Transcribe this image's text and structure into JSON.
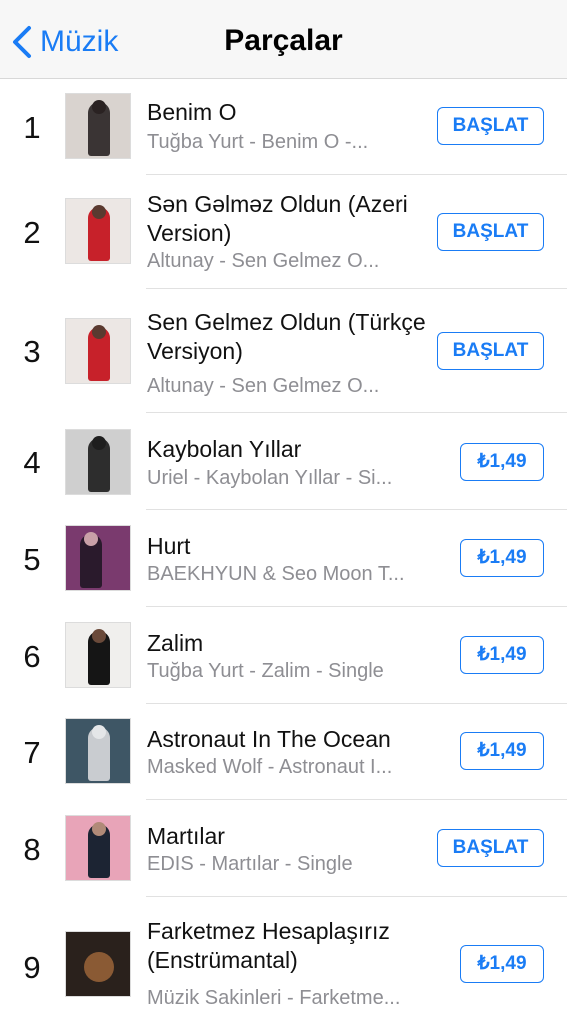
{
  "navbar": {
    "back_label": "Müzik",
    "title": "Parçalar"
  },
  "tracks": [
    {
      "rank": "1",
      "title": "Benim O",
      "subtitle": "Tuğba Yurt - Benim O -...",
      "action": "BAŞLAT"
    },
    {
      "rank": "2",
      "title": "Sən Gəlməz Oldun (Azeri Version)",
      "subtitle": "Altunay - Sen Gelmez O...",
      "action": "BAŞLAT"
    },
    {
      "rank": "3",
      "title": "Sen Gelmez Oldun (Türkçe Versiyon)",
      "subtitle": "Altunay - Sen Gelmez O...",
      "action": "BAŞLAT"
    },
    {
      "rank": "4",
      "title": "Kaybolan Yıllar",
      "subtitle": "Uriel - Kaybolan Yıllar - Si...",
      "action": "₺1,49"
    },
    {
      "rank": "5",
      "title": "Hurt",
      "subtitle": "BAEKHYUN & Seo Moon T...",
      "action": "₺1,49"
    },
    {
      "rank": "6",
      "title": "Zalim",
      "subtitle": "Tuğba Yurt - Zalim - Single",
      "action": "₺1,49"
    },
    {
      "rank": "7",
      "title": "Astronaut In The Ocean",
      "subtitle": "Masked Wolf - Astronaut I...",
      "action": "₺1,49"
    },
    {
      "rank": "8",
      "title": "Martılar",
      "subtitle": "EDIS - Martılar - Single",
      "action": "BAŞLAT"
    },
    {
      "rank": "9",
      "title": "Farketmez Hesaplaşırız (Enstrümantal)",
      "subtitle": "Müzik Sakinleri - Farketme...",
      "action": "₺1,49"
    }
  ],
  "colors": {
    "accent": "#1a7cf5",
    "secondary_text": "#8e8e93"
  }
}
